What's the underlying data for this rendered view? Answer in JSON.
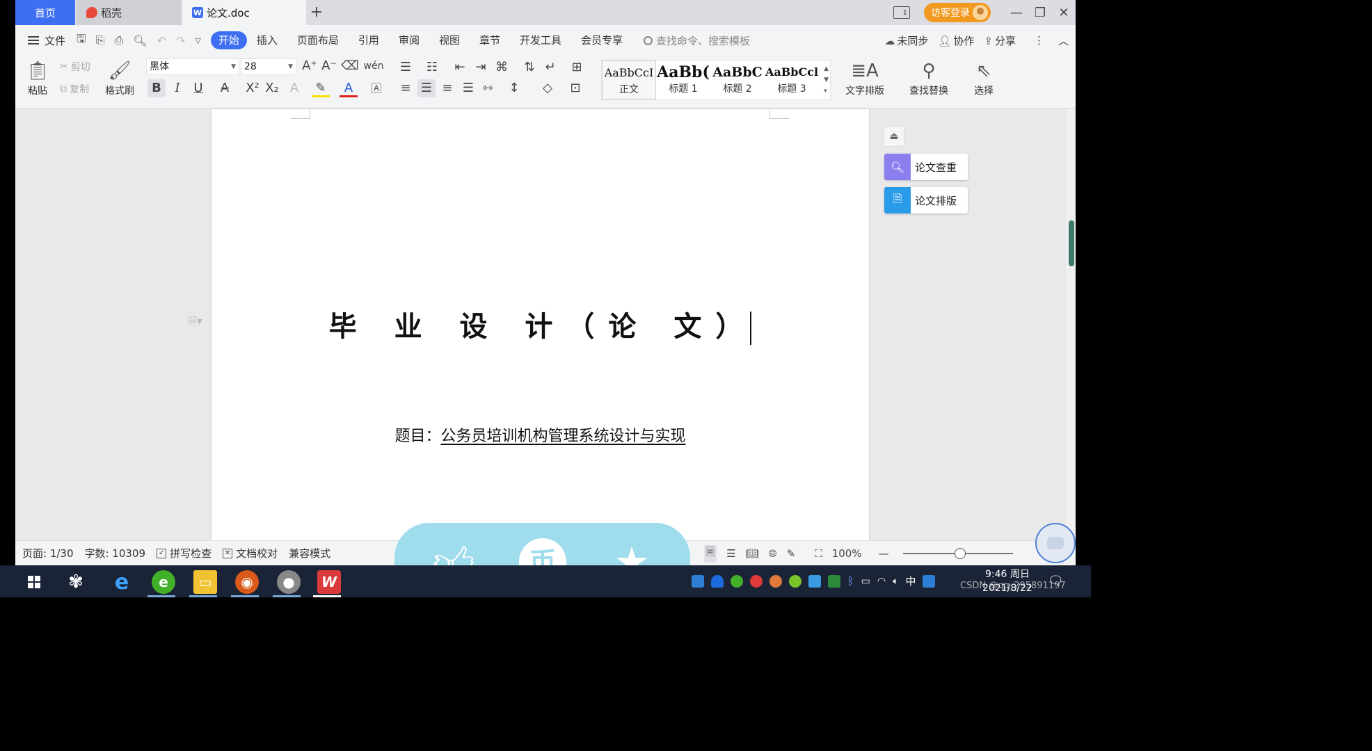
{
  "tabs": {
    "home": "首页",
    "daoke": "稻壳",
    "doc": "论文.doc"
  },
  "titlebar": {
    "login": "访客登录"
  },
  "menu": {
    "file": "文件",
    "items": [
      "开始",
      "插入",
      "页面布局",
      "引用",
      "审阅",
      "视图",
      "章节",
      "开发工具",
      "会员专享"
    ],
    "active": "开始",
    "search_placeholder": "查找命令、搜索模板",
    "sync": "未同步",
    "collab": "协作",
    "share": "分享"
  },
  "ribbon": {
    "paste": "粘贴",
    "cut": "剪切",
    "copy": "复制",
    "format_painter": "格式刷",
    "font_name": "黑体",
    "font_size": "28",
    "styles": [
      {
        "preview": "AaBbCcI",
        "name": "正文"
      },
      {
        "preview": "AaBb(",
        "name": "标题 1"
      },
      {
        "preview": "AaBbC",
        "name": "标题 2"
      },
      {
        "preview": "AaBbCcl",
        "name": "标题 3"
      }
    ],
    "text_layout": "文字排版",
    "find_replace": "查找替换",
    "select": "选择"
  },
  "document": {
    "title": "毕 业 设 计（论 文）",
    "subject_label": "题目：",
    "subject_value": "公务员培训机构管理系统设计与实现"
  },
  "side_panel": {
    "check": "论文查重",
    "layout": "论文排版"
  },
  "statusbar": {
    "page": "页面: 1/30",
    "word_count": "字数: 10309",
    "spell_check": "拼写检查",
    "proofread": "文档校对",
    "compat_mode": "兼容模式",
    "zoom": "100%"
  },
  "taskbar": {
    "time": "9:46 周日",
    "date": "2021/8/22",
    "ime": "中"
  },
  "watermark": "CSDN @qq_295891197",
  "colors": {
    "accent": "#3e6ff2",
    "login": "#f29a1f",
    "overlay": "#9fdcec",
    "taskbar": "#1a2436"
  }
}
